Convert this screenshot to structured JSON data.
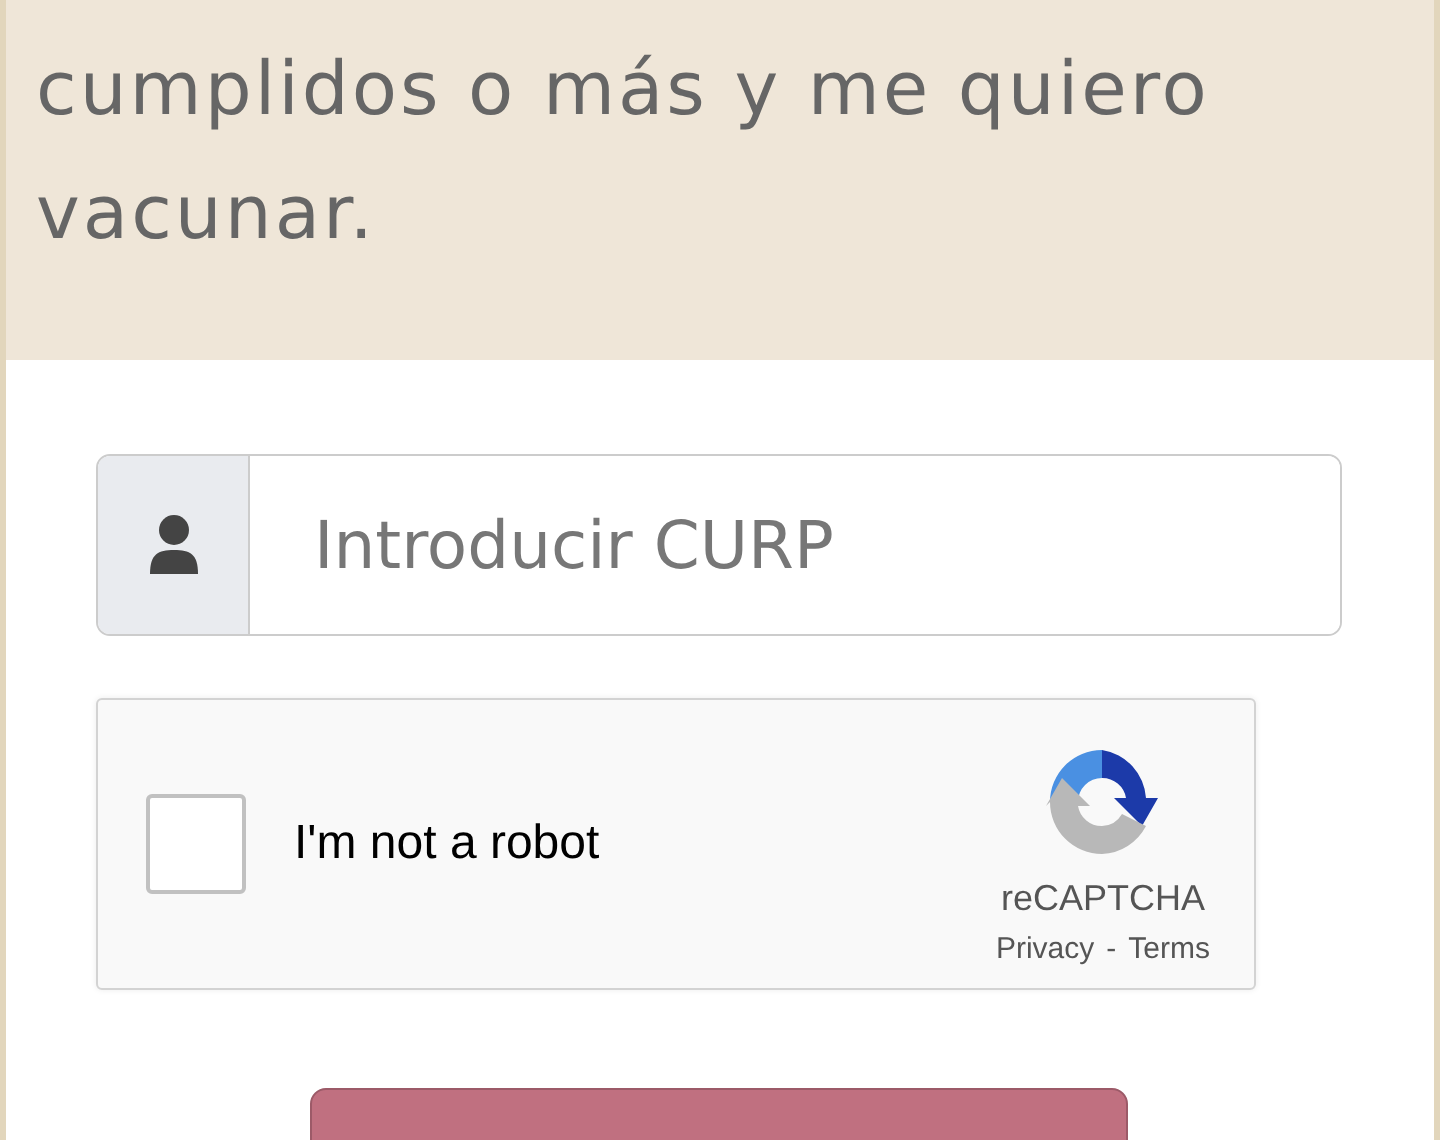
{
  "intro": {
    "text": "cumplidos o más y me quiero vacunar."
  },
  "curp_field": {
    "placeholder": "Introducir CURP"
  },
  "captcha": {
    "label": "I'm not a robot",
    "checked": false,
    "brand": "reCAPTCHA",
    "privacy_link": "Privacy",
    "separator": "-",
    "terms_link": "Terms"
  }
}
